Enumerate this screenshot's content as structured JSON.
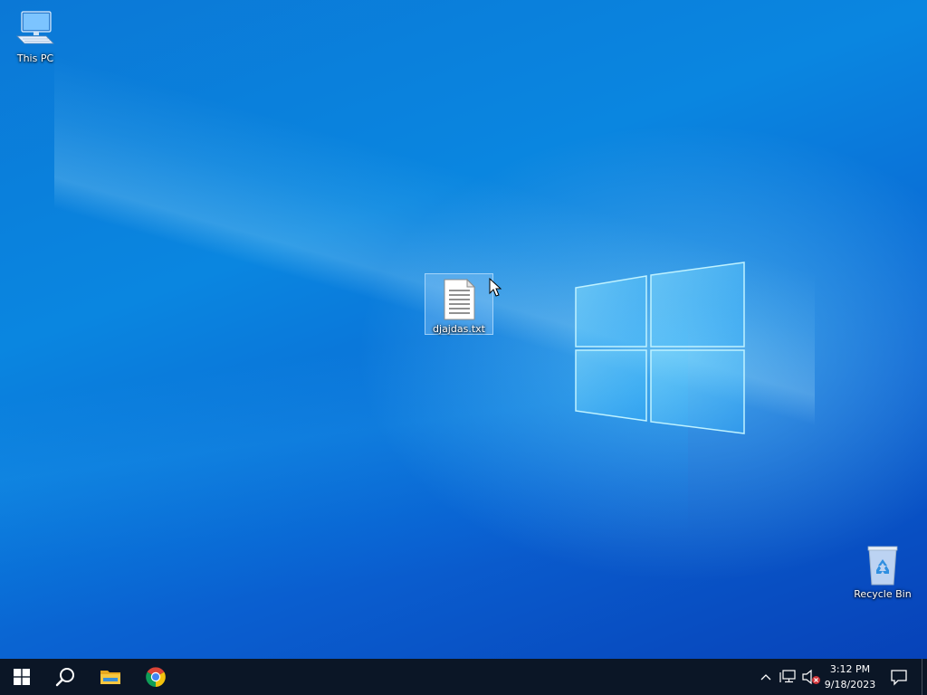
{
  "desktop": {
    "icons": [
      {
        "name": "This PC",
        "icon": "computer-icon"
      },
      {
        "name": "djajdas.txt",
        "icon": "text-document-icon",
        "selected": true
      },
      {
        "name": "Recycle Bin",
        "icon": "recycle-bin-icon"
      }
    ]
  },
  "taskbar": {
    "start": {
      "icon": "windows-start-icon"
    },
    "search": {
      "icon": "search-icon"
    },
    "pinned": [
      {
        "app": "File Explorer",
        "icon": "folder-icon"
      },
      {
        "app": "Google Chrome",
        "icon": "chrome-icon"
      }
    ],
    "tray": {
      "icons": [
        "chevron-up-icon",
        "network-icon",
        "volume-muted-icon"
      ],
      "time": "3:12 PM",
      "date": "9/18/2023"
    },
    "notifications": {
      "icon": "action-center-icon"
    }
  },
  "colors": {
    "taskbar_bg": "#0b1626",
    "desktop_blue": "#0a86e0",
    "selection_bg": "#add6ff"
  }
}
